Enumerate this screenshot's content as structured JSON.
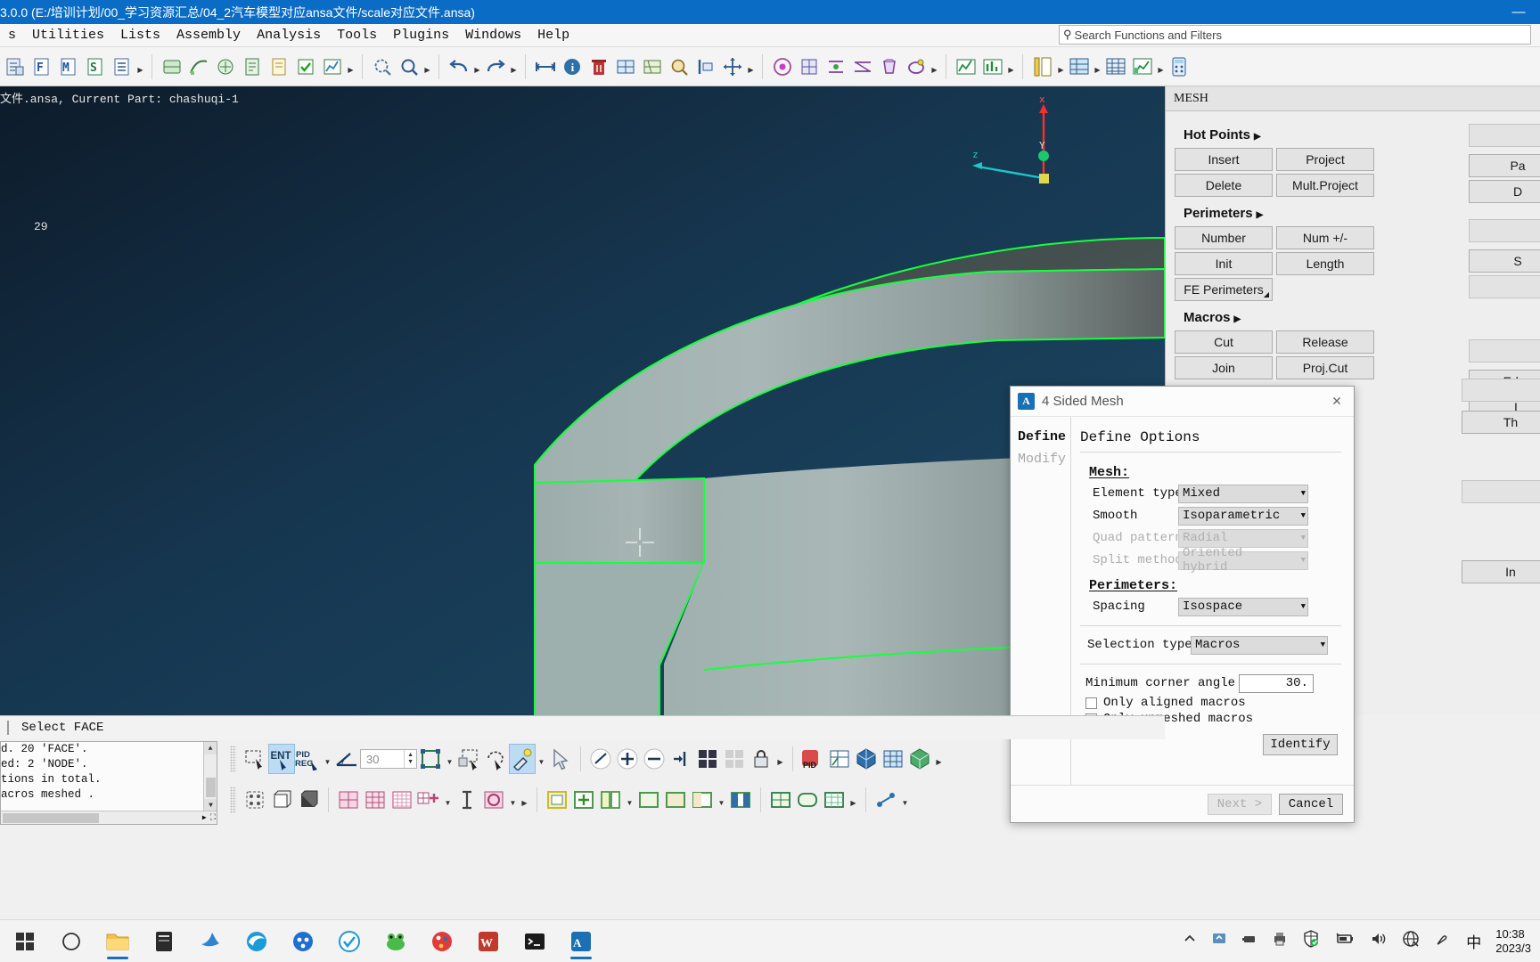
{
  "titlebar": {
    "text": "3.0.0 (E:/培训计划/00_学习资源汇总/04_2汽车模型对应ansa文件/scale对应文件.ansa)",
    "minimize": "—",
    "maximize": "▢",
    "close": "✕"
  },
  "menubar": {
    "items": [
      "s",
      "Utilities",
      "Lists",
      "Assembly",
      "Analysis",
      "Tools",
      "Plugins",
      "Windows",
      "Help"
    ]
  },
  "search": {
    "placeholder": "Search Functions and Filters",
    "icon": "search-icon"
  },
  "viewport": {
    "info": "文件.ansa,  Current Part: chashuqi-1",
    "count": "29",
    "axis_x": "x",
    "axis_y": "Y",
    "axis_z": "z"
  },
  "right_panel": {
    "title": "MESH",
    "groups": [
      {
        "label": "Hot Points",
        "rows": [
          [
            "Insert",
            "Project",
            "Pa"
          ],
          [
            "Delete",
            "Mult.Project",
            "D"
          ]
        ]
      },
      {
        "label": "Perimeters",
        "rows": [
          [
            "Number",
            "Num +/-",
            "S"
          ],
          [
            "Init",
            "Length",
            ""
          ]
        ],
        "extra": "FE Perimeters"
      },
      {
        "label": "Macros",
        "rows": [
          [
            "Cut",
            "Release",
            "Edge"
          ],
          [
            "Join",
            "Proj.Cut",
            "L"
          ]
        ]
      }
    ],
    "far_col": [
      "",
      "Th",
      "",
      "In"
    ]
  },
  "dialog": {
    "title": "4 Sided Mesh",
    "icon": "ansa-logo-icon",
    "close": "✕",
    "tabs": [
      {
        "label": "Define",
        "active": true
      },
      {
        "label": "Modify",
        "active": false
      }
    ],
    "section_title": "Define Options",
    "mesh_header": "Mesh:",
    "fields": [
      {
        "label": "Element type",
        "value": "Mixed",
        "disabled": false,
        "type": "select"
      },
      {
        "label": "Smooth",
        "value": "Isoparametric",
        "disabled": false,
        "type": "select"
      },
      {
        "label": "Quad pattern",
        "value": "Radial",
        "disabled": true,
        "type": "select"
      },
      {
        "label": "Split method",
        "value": "Oriented hybrid",
        "disabled": true,
        "type": "select"
      }
    ],
    "perimeters_header": "Perimeters:",
    "spacing": {
      "label": "Spacing",
      "value": "Isospace"
    },
    "selection": {
      "label": "Selection type",
      "value": "Macros"
    },
    "min_angle": {
      "label": "Minimum corner angle",
      "value": "30."
    },
    "checkboxes": [
      {
        "label": "Only aligned macros",
        "checked": false
      },
      {
        "label": "Only unmeshed macros",
        "checked": false
      }
    ],
    "identify_button": "Identify",
    "next_button": "Next >",
    "cancel_button": "Cancel"
  },
  "prompt": {
    "text": "Select FACE"
  },
  "log": {
    "lines": [
      "d.        20 'FACE'.",
      "ed:        2 'NODE'.",
      "tions in total.",
      "acros meshed ."
    ]
  },
  "bottom_toolbar": {
    "angle_value": "30",
    "ent_label": "ENT",
    "pid_label": "PID",
    "reg_label": "REG",
    "pid_label2": "PID"
  },
  "taskbar": {
    "start_icon": "windows-start-icon",
    "search_icon": "search-circle-icon",
    "apps": [
      "file-explorer-icon",
      "notes-icon",
      "dolphin-icon",
      "edge-icon",
      "bluetooth-blue-icon",
      "check-circle-icon",
      "frog-icon",
      "palette-icon",
      "wps-icon",
      "terminal-icon",
      "ansa-icon"
    ],
    "tray": [
      "chevron-up-icon",
      "update-icon",
      "usb-icon",
      "printer-icon",
      "shield-icon",
      "battery-icon",
      "volume-icon",
      "network-icon",
      "pen-icon",
      "ime-icon"
    ],
    "ime": "中",
    "clock_time": "10:38",
    "clock_date": "2023/3"
  }
}
